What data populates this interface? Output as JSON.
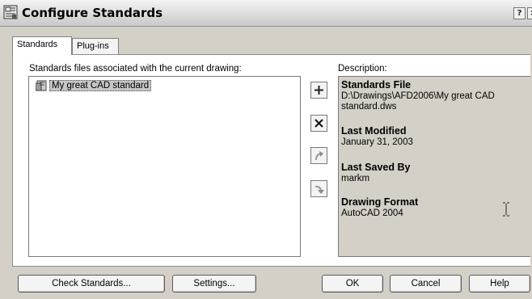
{
  "window": {
    "title": "Configure Standards",
    "help_glyph": "?",
    "close_glyph": "×"
  },
  "tabs": [
    {
      "label": "Standards"
    },
    {
      "label": "Plug-ins"
    }
  ],
  "standards": {
    "list_label": "Standards files associated with the current drawing:",
    "items": [
      {
        "label": "My great CAD standard"
      }
    ],
    "description_label": "Description:"
  },
  "description": {
    "file_heading": "Standards File",
    "file_value": "D:\\Drawings\\AFD2006\\My great CAD standard.dws",
    "modified_heading": "Last Modified",
    "modified_value": "January 31, 2003",
    "saved_by_heading": "Last Saved By",
    "saved_by_value": "markm",
    "format_heading": "Drawing Format",
    "format_value": "AutoCAD 2004"
  },
  "buttons": {
    "check": "Check Standards...",
    "settings": "Settings...",
    "ok": "OK",
    "cancel": "Cancel",
    "help": "Help"
  },
  "colors": {
    "dialog_bg": "#d4d0c8",
    "selection_bg": "#c6c6c6"
  }
}
